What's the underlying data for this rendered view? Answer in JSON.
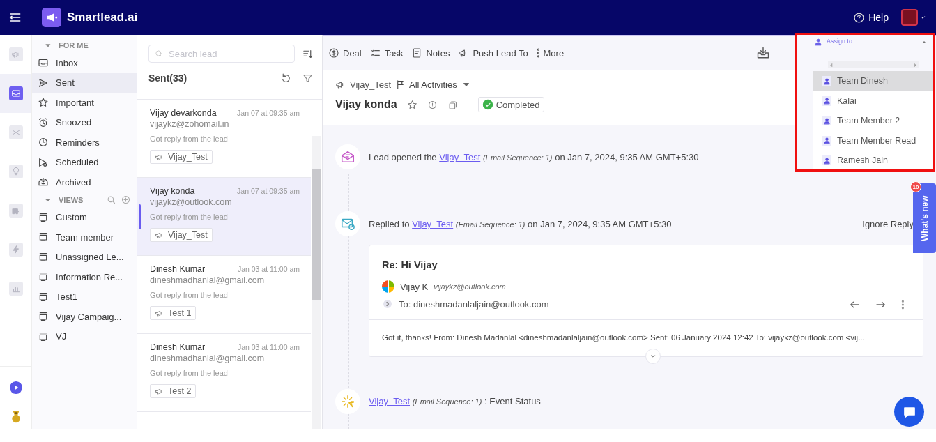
{
  "topbar": {
    "brand": "Smartlead.ai",
    "help": "Help"
  },
  "rail": [
    {
      "selected": false
    },
    {
      "selected": true
    },
    {
      "selected": false
    },
    {
      "selected": false
    },
    {
      "selected": false
    },
    {
      "selected": false
    },
    {
      "selected": false
    }
  ],
  "nav": {
    "sections": [
      {
        "title": "FOR ME",
        "expanded": true,
        "items": [
          {
            "label": "Inbox",
            "selected": false
          },
          {
            "label": "Sent",
            "selected": true
          },
          {
            "label": "Important",
            "selected": false
          },
          {
            "label": "Snoozed",
            "selected": false
          },
          {
            "label": "Reminders",
            "selected": false
          },
          {
            "label": "Scheduled",
            "selected": false
          },
          {
            "label": "Archived",
            "selected": false
          }
        ]
      },
      {
        "title": "VIEWS",
        "expanded": true,
        "items": [
          {
            "label": "Custom",
            "selected": false
          },
          {
            "label": "Team member",
            "selected": false
          },
          {
            "label": "Unassigned Le...",
            "selected": false
          },
          {
            "label": "Information Re...",
            "selected": false
          },
          {
            "label": "Test1",
            "selected": false
          },
          {
            "label": "Vijay Campaig...",
            "selected": false
          },
          {
            "label": "VJ",
            "selected": false
          }
        ]
      }
    ]
  },
  "leads": {
    "search": {
      "placeholder": "Search lead"
    },
    "title": "Sent(33)",
    "items": [
      {
        "name": "Vijay devarkonda",
        "time": "Jan 07 at 09:35 am",
        "email": "vijaykz@zohomail.in",
        "status": "Got reply from the lead",
        "campaign": "Vijay_Test",
        "selected": false
      },
      {
        "name": "Vijay konda",
        "time": "Jan 07 at 09:35 am",
        "email": "vijaykz@outlook.com",
        "status": "Got reply from the lead",
        "campaign": "Vijay_Test",
        "selected": true
      },
      {
        "name": "Dinesh Kumar",
        "time": "Jan 03 at 11:00 am",
        "email": "dineshmadhanlal@gmail.com",
        "status": "Got reply from the lead",
        "campaign": "Test 1",
        "selected": false
      },
      {
        "name": "Dinesh Kumar",
        "time": "Jan 03 at 11:00 am",
        "email": "dineshmadhanlal@gmail.com",
        "status": "Got reply from the lead",
        "campaign": "Test 2",
        "selected": false
      }
    ]
  },
  "toolbar": {
    "actions": [
      "Deal",
      "Task",
      "Notes",
      "Push Lead To",
      "More"
    ]
  },
  "lead": {
    "campaign": "Vijay_Test",
    "filter": "All Activities",
    "name": "Vijay konda",
    "starred": false,
    "status": {
      "label": "Completed",
      "kind": "completed"
    }
  },
  "timeline": [
    {
      "kind": "opened",
      "prefix": "Lead opened the",
      "link": "Vijay_Test",
      "sequence": "(Email Sequence: 1)",
      "suffix": "on Jan 7, 2024, 9:35 AM GMT+5:30"
    },
    {
      "kind": "replied",
      "prefix": "Replied to",
      "link": "Vijay_Test",
      "sequence": "(Email Sequence: 1)",
      "suffix": "on Jan 7, 2024, 9:35 AM GMT+5:30",
      "action": "Ignore Reply",
      "email": {
        "subject": "Re: Hi Vijay",
        "sender": "Vijay K",
        "sender_email": "vijaykz@outlook.com",
        "to": "To: dineshmadanlaljain@outlook.com",
        "body": "Got it, thanks! From: Dinesh Madanlal <dineshmadanlaljain@outlook.com> Sent: 06 January 2024 12:42 To: vijaykz@outlook.com <vij..."
      }
    },
    {
      "kind": "status",
      "link": "Vijay_Test",
      "sequence": "(Email Sequence: 1)",
      "suffix": ": Event Status"
    }
  ],
  "assign": {
    "label": "Assign to",
    "expanded": true,
    "options": [
      {
        "label": "Team Dinesh",
        "selected": true
      },
      {
        "label": "Kalai",
        "selected": false
      },
      {
        "label": "Team Member 2",
        "selected": false
      },
      {
        "label": "Team Member Read",
        "selected": false
      },
      {
        "label": "Ramesh Jain",
        "selected": false
      }
    ]
  },
  "whats_new": {
    "label": "What's new",
    "count": "10"
  }
}
